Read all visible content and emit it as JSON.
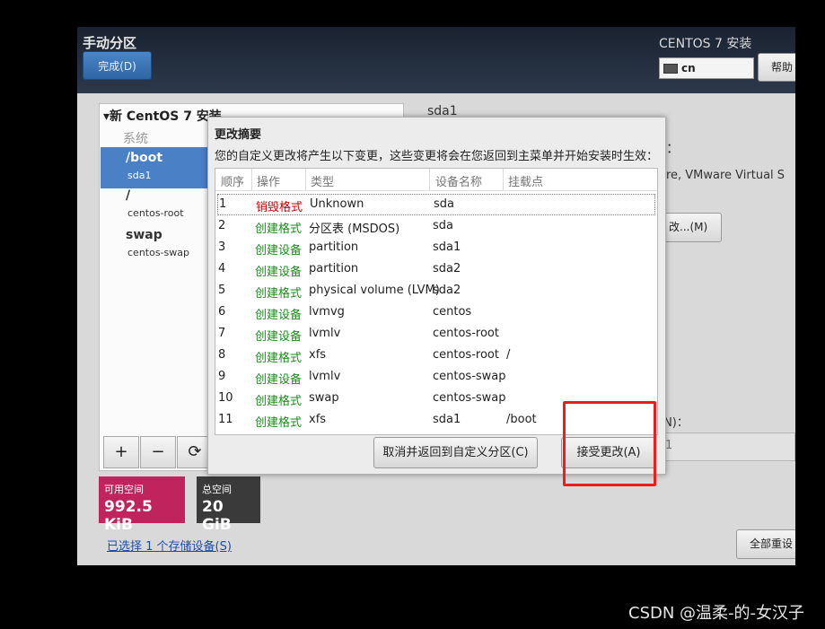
{
  "header": {
    "title": "手动分区",
    "done_label": "完成(D)",
    "product": "CENTOS 7 安装",
    "keyboard": "cn",
    "help_label": "帮助"
  },
  "left": {
    "install_title": "新 CentOS 7 安装",
    "system_label": "系统",
    "mounts": [
      {
        "name": "/boot",
        "device": "sda1"
      },
      {
        "name": "/",
        "device": "centos-root"
      },
      {
        "name": "swap",
        "device": "centos-swap"
      }
    ],
    "buttons": [
      "+",
      "−",
      "⟳"
    ],
    "available_label": "可用空间",
    "available_value": "992.5 KiB",
    "total_label": "总空间",
    "total_value": "20 GiB",
    "selected_link": "已选择 1 个存储设备(S)"
  },
  "right": {
    "device_title": "sda1",
    "colon": "：",
    "device_desc": "are, VMware Virtual S",
    "modify_label": "改...(M)",
    "size_label": "(N)：",
    "size_value": "1",
    "reset_label": "全部重设"
  },
  "dialog": {
    "title": "更改摘要",
    "description": "您的自定义更改将产生以下变更，这些变更将会在您返回到主菜单并开始安装时生效：",
    "columns": [
      "顺序",
      "操作",
      "类型",
      "设备名称",
      "挂载点"
    ],
    "rows": [
      {
        "order": "1",
        "action": "销毁格式",
        "type": "Unknown",
        "device": "sda",
        "mount": "",
        "action_color": "#cc0000"
      },
      {
        "order": "2",
        "action": "创建格式",
        "type": "分区表 (MSDOS)",
        "device": "sda",
        "mount": "",
        "action_color": "#1f8a1f"
      },
      {
        "order": "3",
        "action": "创建设备",
        "type": "partition",
        "device": "sda1",
        "mount": "",
        "action_color": "#1f8a1f"
      },
      {
        "order": "4",
        "action": "创建设备",
        "type": "partition",
        "device": "sda2",
        "mount": "",
        "action_color": "#1f8a1f"
      },
      {
        "order": "5",
        "action": "创建格式",
        "type": "physical volume (LVM)",
        "device": "sda2",
        "mount": "",
        "action_color": "#1f8a1f"
      },
      {
        "order": "6",
        "action": "创建设备",
        "type": "lvmvg",
        "device": "centos",
        "mount": "",
        "action_color": "#1f8a1f"
      },
      {
        "order": "7",
        "action": "创建设备",
        "type": "lvmlv",
        "device": "centos-root",
        "mount": "",
        "action_color": "#1f8a1f"
      },
      {
        "order": "8",
        "action": "创建格式",
        "type": "xfs",
        "device": "centos-root",
        "mount": "/",
        "action_color": "#1f8a1f"
      },
      {
        "order": "9",
        "action": "创建设备",
        "type": "lvmlv",
        "device": "centos-swap",
        "mount": "",
        "action_color": "#1f8a1f"
      },
      {
        "order": "10",
        "action": "创建格式",
        "type": "swap",
        "device": "centos-swap",
        "mount": "",
        "action_color": "#1f8a1f"
      },
      {
        "order": "11",
        "action": "创建格式",
        "type": "xfs",
        "device": "sda1",
        "mount": "/boot",
        "action_color": "#1f8a1f"
      }
    ],
    "cancel_label": "取消并返回到自定义分区(C)",
    "accept_label": "接受更改(A)"
  },
  "colors": {
    "available_bg": "#c0245c",
    "total_bg": "#3a3a3a",
    "highlight": "#ee1c1c"
  },
  "watermark": "CSDN @温柔-的-女汉子"
}
